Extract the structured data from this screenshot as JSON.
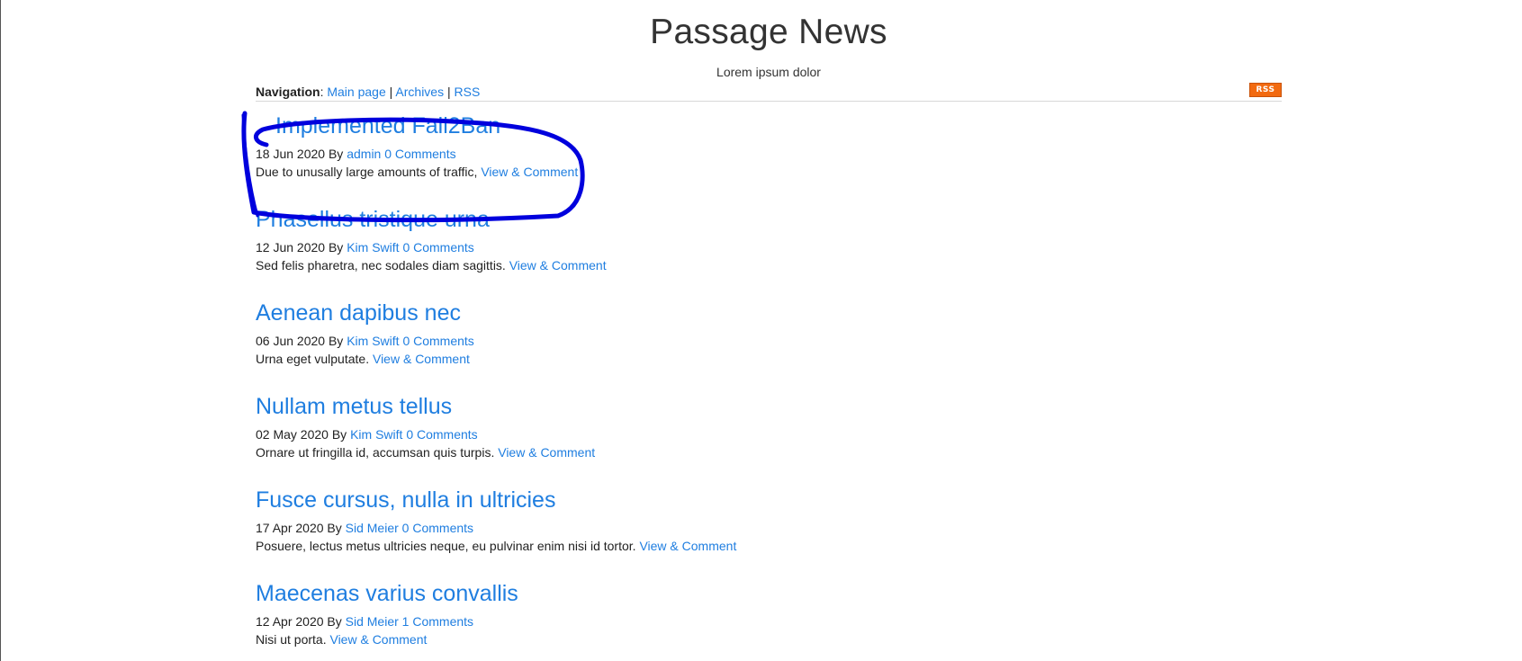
{
  "site": {
    "title": "Passage News",
    "tagline": "Lorem ipsum dolor"
  },
  "nav": {
    "label": "Navigation",
    "colon": ":",
    "separator": "|",
    "items": [
      {
        "label": "Main page"
      },
      {
        "label": "Archives"
      },
      {
        "label": "RSS"
      }
    ],
    "rss_badge": "RSS"
  },
  "colors": {
    "link": "#1f7ee0",
    "rss_badge": "#f26a10",
    "annotation": "#0000dd"
  },
  "posts": [
    {
      "title": "Implemented Fail2Ban",
      "date": "18 Jun 2020",
      "by": "By",
      "author": "admin",
      "comments": "0 Comments",
      "excerpt": "Due to unusally large amounts of traffic,",
      "more": "View & Comment"
    },
    {
      "title": "Phasellus tristique urna",
      "date": "12 Jun 2020",
      "by": "By",
      "author": "Kim Swift",
      "comments": "0 Comments",
      "excerpt": "Sed felis pharetra, nec sodales diam sagittis.",
      "more": "View & Comment"
    },
    {
      "title": "Aenean dapibus nec",
      "date": "06 Jun 2020",
      "by": "By",
      "author": "Kim Swift",
      "comments": "0 Comments",
      "excerpt": "Urna eget vulputate.",
      "more": "View & Comment"
    },
    {
      "title": "Nullam metus tellus",
      "date": "02 May 2020",
      "by": "By",
      "author": "Kim Swift",
      "comments": "0 Comments",
      "excerpt": "Ornare ut fringilla id, accumsan quis turpis.",
      "more": "View & Comment"
    },
    {
      "title": "Fusce cursus, nulla in ultricies",
      "date": "17 Apr 2020",
      "by": "By",
      "author": "Sid Meier",
      "comments": "0 Comments",
      "excerpt": "Posuere, lectus metus ultricies neque, eu pulvinar enim nisi id tortor.",
      "more": "View & Comment"
    },
    {
      "title": "Maecenas varius convallis",
      "date": "12 Apr 2020",
      "by": "By",
      "author": "Sid Meier",
      "comments": "1 Comments",
      "excerpt": "Nisi ut porta.",
      "more": "View & Comment"
    }
  ]
}
